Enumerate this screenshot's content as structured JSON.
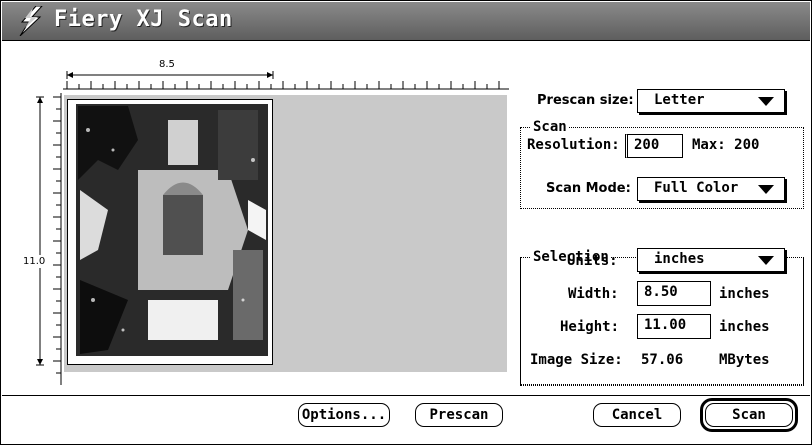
{
  "window": {
    "title": "Fiery XJ Scan",
    "icon": "lightning-bolt-icon"
  },
  "preview": {
    "ruler_top_label": "8.5",
    "ruler_left_label": "11.0",
    "image_description_icon": "scanned-photo-thumbnail"
  },
  "prescan": {
    "label": "Prescan size:",
    "value": "Letter"
  },
  "scan_group": {
    "title": "Scan",
    "resolution_label": "Resolution:",
    "resolution_value": "200",
    "max_text": "Max: 200",
    "mode_label": "Scan Mode:",
    "mode_value": "Full Color"
  },
  "selection_group": {
    "title": "Selection",
    "units_label": "Units:",
    "units_value": "inches",
    "width_label": "Width:",
    "width_value": "8.50",
    "width_unit": "inches",
    "height_label": "Height:",
    "height_value": "11.00",
    "height_unit": "inches",
    "image_size_label": "Image Size:",
    "image_size_value": "57.06",
    "image_size_unit": "MBytes"
  },
  "buttons": {
    "options": "Options...",
    "prescan": "Prescan",
    "cancel": "Cancel",
    "scan": "Scan"
  }
}
